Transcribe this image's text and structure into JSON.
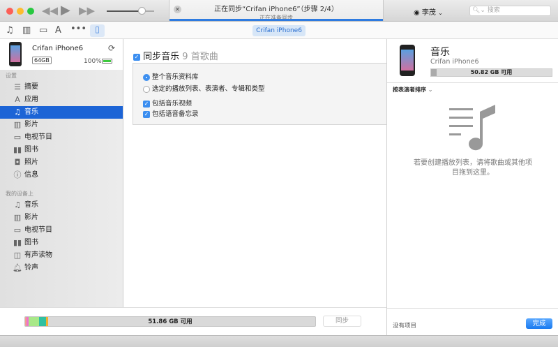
{
  "titlebar": {
    "sync_title": "正在同步“Crifan iPhone6”（步骤 2/4）",
    "sync_subtitle": "正在准备同步",
    "user": "李茂",
    "search_placeholder": "搜索",
    "colors": {
      "progress": "#2e7be0"
    }
  },
  "toolbar": {
    "device_tab": "Crifan iPhone6"
  },
  "device": {
    "name": "Crifan iPhone6",
    "capacity": "64GB",
    "battery": "100%"
  },
  "sidebar": {
    "settings_header": "设置",
    "settings": [
      {
        "label": "摘要",
        "icon": "summary-icon"
      },
      {
        "label": "应用",
        "icon": "apps-icon"
      },
      {
        "label": "音乐",
        "icon": "music-icon",
        "selected": true
      },
      {
        "label": "影片",
        "icon": "film-icon"
      },
      {
        "label": "电视节目",
        "icon": "tv-icon"
      },
      {
        "label": "图书",
        "icon": "book-icon"
      },
      {
        "label": "照片",
        "icon": "camera-icon"
      },
      {
        "label": "信息",
        "icon": "info-icon"
      }
    ],
    "ondevice_header": "我的设备上",
    "ondevice": [
      {
        "label": "音乐",
        "icon": "music-icon"
      },
      {
        "label": "影片",
        "icon": "film-icon"
      },
      {
        "label": "电视节目",
        "icon": "tv-icon"
      },
      {
        "label": "图书",
        "icon": "book-icon"
      },
      {
        "label": "有声读物",
        "icon": "audiobook-icon"
      },
      {
        "label": "铃声",
        "icon": "bell-icon"
      }
    ]
  },
  "main": {
    "sync_label": "同步音乐",
    "song_count": "9 首歌曲",
    "options": {
      "entire_library": "整个音乐资料库",
      "selected": "选定的播放列表、表演者、专辑和类型",
      "include_videos": "包括音乐视频",
      "include_memos": "包括语音备忘录"
    },
    "selected_option": "entire_library"
  },
  "storage": {
    "free_label": "51.86 GB 可用",
    "sync_button": "同步"
  },
  "right": {
    "title": "音乐",
    "device": "Crifan iPhone6",
    "free_label": "50.82 GB 可用",
    "sort_label": "按表演者排序",
    "empty_message_1": "若要创建播放列表，请将歌曲或其他项",
    "empty_message_2": "目拖到这里。",
    "no_items": "没有项目",
    "done_button": "完成"
  }
}
